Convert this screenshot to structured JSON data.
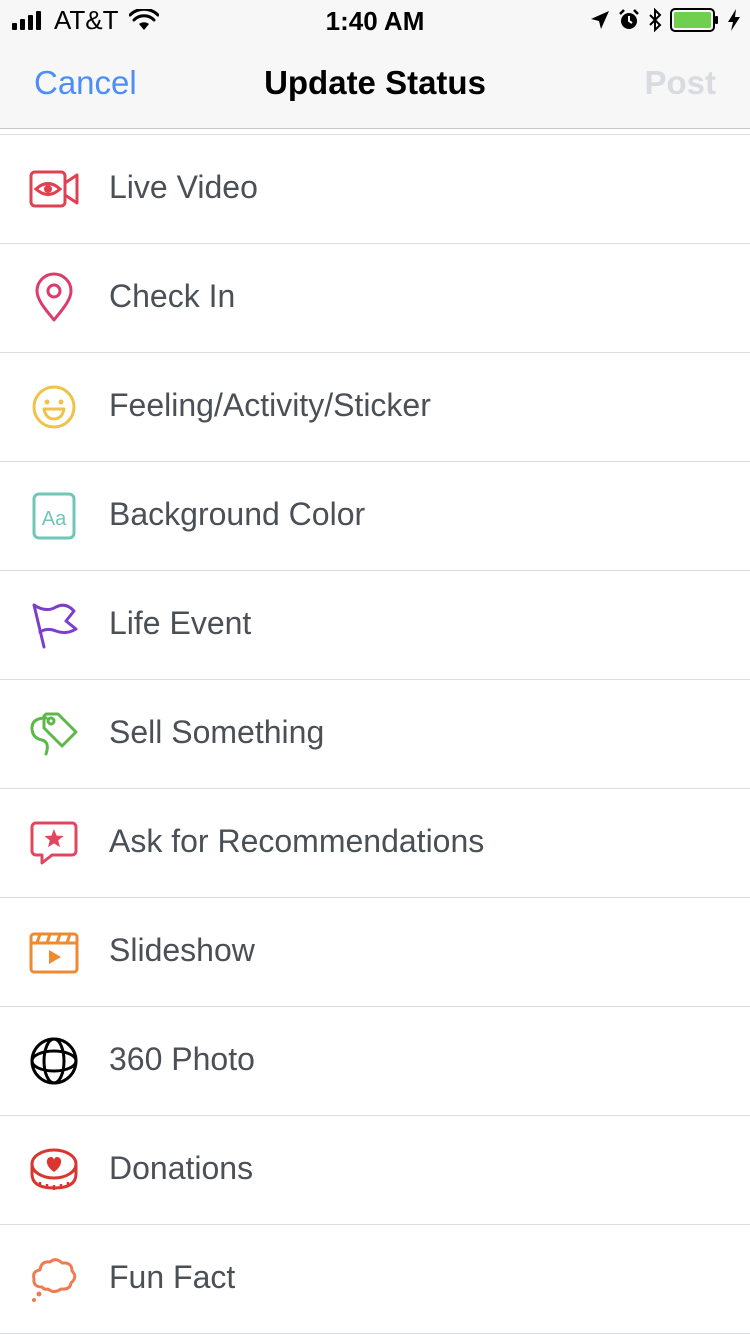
{
  "status_bar": {
    "carrier": "AT&T",
    "time": "1:40 AM",
    "battery_color": "#6fd04f"
  },
  "nav": {
    "cancel_label": "Cancel",
    "title": "Update Status",
    "post_label": "Post"
  },
  "options": [
    {
      "label": "Live Video",
      "icon": "live-video-icon",
      "color": "#e0404f"
    },
    {
      "label": "Check In",
      "icon": "location-pin-icon",
      "color": "#dc3c6c"
    },
    {
      "label": "Feeling/Activity/Sticker",
      "icon": "smiley-icon",
      "color": "#efc34a"
    },
    {
      "label": "Background Color",
      "icon": "text-background-icon",
      "color": "#6fc7b5"
    },
    {
      "label": "Life Event",
      "icon": "flag-icon",
      "color": "#7b3fc9"
    },
    {
      "label": "Sell Something",
      "icon": "price-tag-icon",
      "color": "#5db84a"
    },
    {
      "label": "Ask for Recommendations",
      "icon": "star-speech-bubble-icon",
      "color": "#e0475f"
    },
    {
      "label": "Slideshow",
      "icon": "clapperboard-icon",
      "color": "#ee8a32"
    },
    {
      "label": "360 Photo",
      "icon": "360-globe-icon",
      "color": "#000000"
    },
    {
      "label": "Donations",
      "icon": "heart-coin-icon",
      "color": "#d9362f"
    },
    {
      "label": "Fun Fact",
      "icon": "thought-bubble-icon",
      "color": "#ef7b53"
    }
  ]
}
